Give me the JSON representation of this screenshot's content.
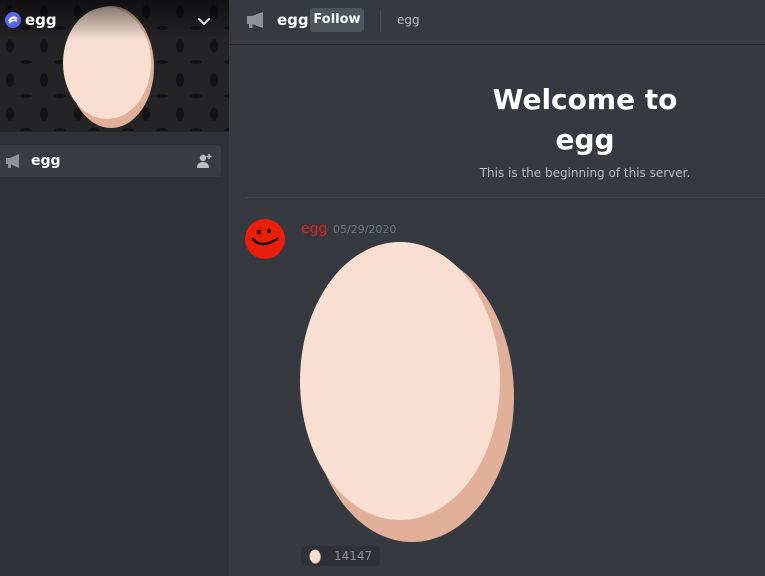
{
  "server": {
    "name": "egg"
  },
  "sidebar": {
    "channels": [
      {
        "name": "egg",
        "type": "announcement",
        "selected": true
      }
    ]
  },
  "channel_header": {
    "name": "egg",
    "follow_label": "Follow",
    "topic": "egg"
  },
  "welcome": {
    "title": "Welcome to egg",
    "subtitle": "This is the beginning of this server."
  },
  "message": {
    "author": "egg",
    "timestamp": "05/29/2020",
    "author_color": "#e0201d",
    "reaction": {
      "emoji": "egg-icon",
      "count": "14147"
    }
  },
  "icons": {
    "server": "server-icon",
    "dropdown": "chevron-down-icon",
    "channel": "announcement-megaphone-icon",
    "invite": "add-member-icon"
  },
  "colors": {
    "sidebar_bg": "#2f3136",
    "main_bg": "#36393f",
    "selected_channel_bg": "#393c43",
    "follow_button_bg": "#4f545c",
    "egg_light": "#f8dfd2",
    "egg_shadow": "#e2b09a"
  }
}
